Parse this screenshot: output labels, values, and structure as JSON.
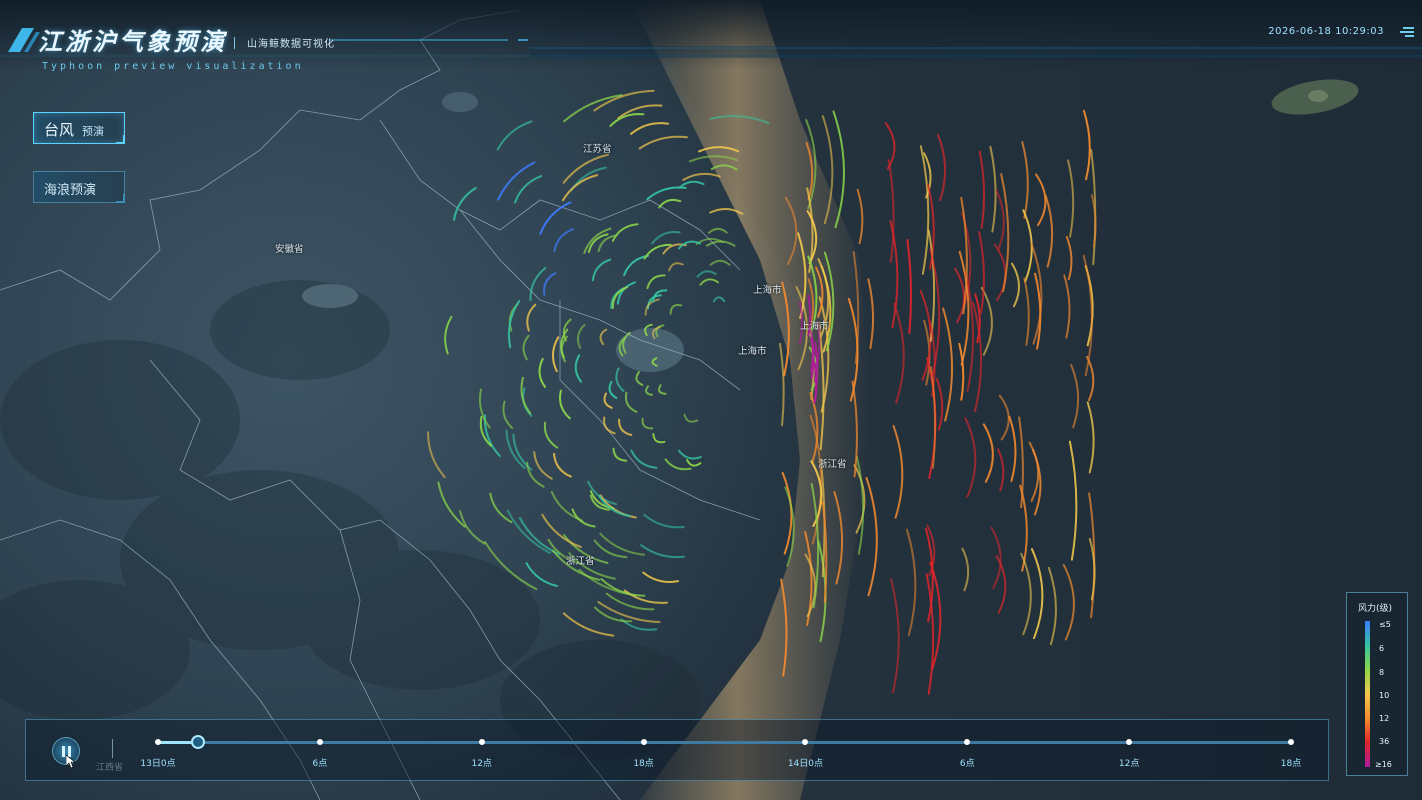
{
  "header": {
    "title": "江浙沪气象预演",
    "subtitle": "山海鲸数据可视化",
    "subtitle_en": "Typhoon preview visualization",
    "datetime": "2026-06-18 10:29:03",
    "menu_icon": "menu-icon"
  },
  "menu": {
    "typhoon": {
      "main": "台风",
      "sub": "预演",
      "active": true
    },
    "waves": {
      "label": "海浪预演",
      "active": false
    }
  },
  "map": {
    "labels": {
      "jiangsu": "江苏省",
      "anhui": "安徽省",
      "shanghai_1": "上海市",
      "shanghai_2": "上海市",
      "shanghai_3": "上海市",
      "zhejiang_1": "浙江省",
      "zhejiang_2": "浙江省"
    }
  },
  "legend": {
    "title": "风力(级)",
    "ticks": [
      "≤5",
      "6",
      "8",
      "10",
      "12",
      "36",
      "≥16"
    ],
    "colors": [
      "#3d7cff",
      "#35c4a0",
      "#8bd64a",
      "#f2c84b",
      "#f38a2e",
      "#e0252a",
      "#b01b9b"
    ]
  },
  "timeline": {
    "province_label": "江西省",
    "ticks": [
      "13日0点",
      "6点",
      "12点",
      "18点",
      "14日0点",
      "6点",
      "12点",
      "18点"
    ],
    "progress": 0.035,
    "playing": true
  }
}
